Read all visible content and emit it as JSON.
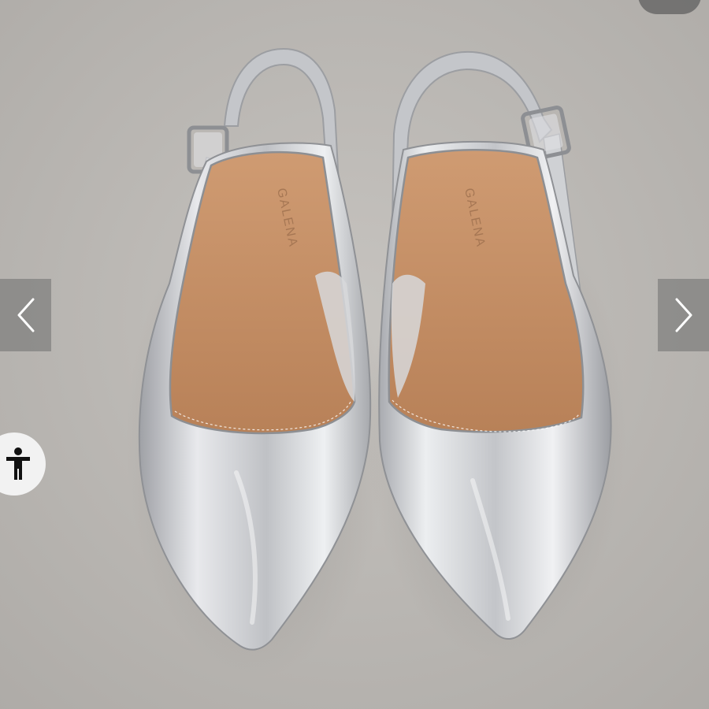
{
  "photo": {
    "insole_brand_left": "GALENA",
    "insole_brand_right": "GALENA",
    "colors": {
      "floor": "#b9b6b2",
      "silver": "#d2d3d6",
      "insole": "#c59067",
      "overlay": "#6e6e6e"
    }
  },
  "controls": {
    "prev_icon": "chevron-left-icon",
    "next_icon": "chevron-right-icon",
    "accessibility_icon": "accessibility-person-icon",
    "top_pill_icon": "menu-pill-icon"
  }
}
